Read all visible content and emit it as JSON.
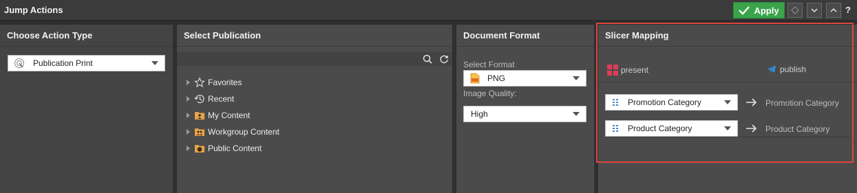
{
  "app": {
    "title": "Jump Actions"
  },
  "toolbar": {
    "apply_label": "Apply",
    "help_label": "?"
  },
  "panels": {
    "action_type": {
      "title": "Choose Action Type",
      "selected": "Publication Print"
    },
    "publication": {
      "title": "Select Publication",
      "tree": [
        {
          "label": "Favorites",
          "icon": "star-icon"
        },
        {
          "label": "Recent",
          "icon": "recent-icon"
        },
        {
          "label": "My Content",
          "icon": "my-content-folder-icon"
        },
        {
          "label": "Workgroup Content",
          "icon": "workgroup-folder-icon"
        },
        {
          "label": "Public Content",
          "icon": "public-folder-icon"
        }
      ]
    },
    "document_format": {
      "title": "Document Format",
      "format_label": "Select Format",
      "format_value": "PNG",
      "quality_label": "Image Quality:",
      "quality_value": "High"
    },
    "slicer_mapping": {
      "title": "Slicer Mapping",
      "source_label": "present",
      "target_label": "publish",
      "mappings": [
        {
          "source": "Promotion Category",
          "target": "Promotion Category"
        },
        {
          "source": "Product Category",
          "target": "Product Category"
        }
      ]
    }
  },
  "colors": {
    "apply": "#3aa34b",
    "highlight": "#e0453f",
    "present_icon": "#e23b5a",
    "publish_icon": "#2f8fe0"
  }
}
